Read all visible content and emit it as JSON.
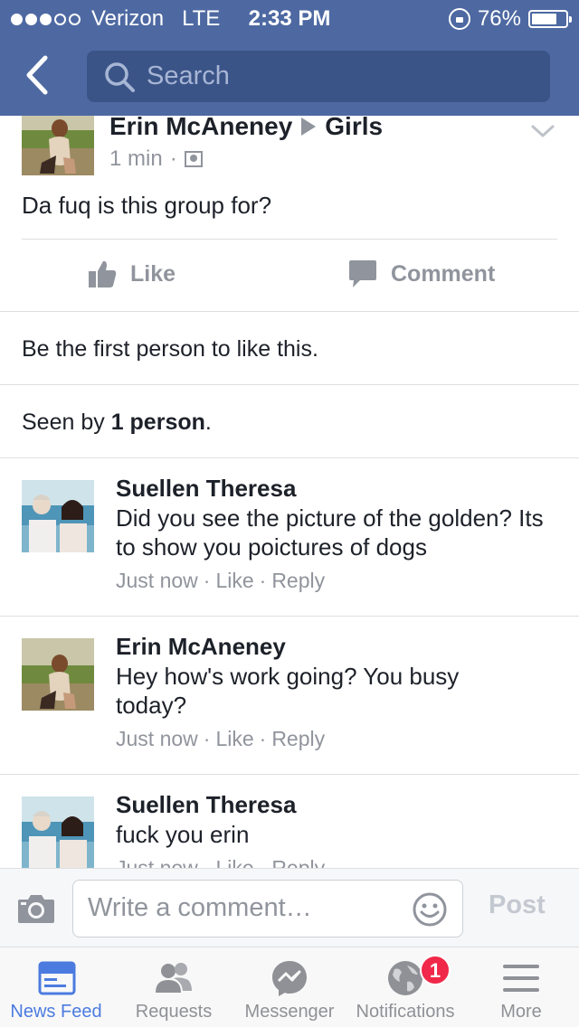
{
  "status_bar": {
    "carrier": "Verizon",
    "network": "LTE",
    "time": "2:33 PM",
    "battery": "76%",
    "battery_level": 0.76,
    "signal_bars_filled": 3,
    "signal_bars_total": 5
  },
  "nav": {
    "back_icon": "chevron-left-icon",
    "search_placeholder": "Search",
    "search_icon": "search-icon"
  },
  "post": {
    "author": "Erin McAneney",
    "group": "Girls",
    "time": "1 min",
    "separator": "·",
    "text": "Da fuq is this group for?",
    "actions": {
      "like": "Like",
      "comment": "Comment"
    },
    "likes_text": "Be the first person to like this.",
    "seen_prefix": "Seen by ",
    "seen_count": "1 person",
    "seen_suffix": "."
  },
  "comments": [
    {
      "author": "Suellen Theresa",
      "text": "Did you see the picture of the golden? Its to show you poictures of dogs",
      "time": "Just now",
      "like": "Like",
      "reply": "Reply"
    },
    {
      "author": "Erin McAneney",
      "text": "Hey how's work going? You busy today?",
      "time": "Just now",
      "like": "Like",
      "reply": "Reply"
    },
    {
      "author": "Suellen Theresa",
      "text": "fuck you erin",
      "time": "Just now",
      "like": "Like",
      "reply": "Reply"
    }
  ],
  "composer": {
    "placeholder": "Write a comment…",
    "post_label": "Post"
  },
  "tabs": [
    {
      "label": "News Feed",
      "icon": "news-feed-icon",
      "active": true
    },
    {
      "label": "Requests",
      "icon": "friend-requests-icon",
      "active": false
    },
    {
      "label": "Messenger",
      "icon": "messenger-icon",
      "active": false
    },
    {
      "label": "Notifications",
      "icon": "globe-icon",
      "active": false,
      "badge": "1"
    },
    {
      "label": "More",
      "icon": "menu-icon",
      "active": false
    }
  ],
  "colors": {
    "brand_blue": "#4e69a2",
    "search_bg": "#3b5488",
    "muted_text": "#90949c",
    "active_tab": "#4c7be0",
    "badge_red": "#f02849"
  }
}
